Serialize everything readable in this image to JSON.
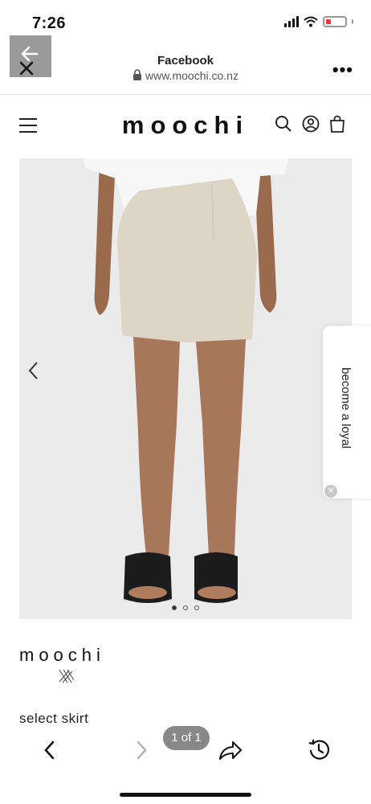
{
  "status_bar": {
    "time": "7:26",
    "icons": [
      "signal-icon",
      "wifi-icon",
      "battery-icon"
    ]
  },
  "browser": {
    "title": "Facebook",
    "url": "www.moochi.co.nz",
    "icons": [
      "back-arrow-icon",
      "close-icon",
      "lock-icon",
      "more-icon"
    ]
  },
  "site_nav": {
    "logo": "moochi",
    "icons": [
      "menu-icon",
      "search-icon",
      "account-icon",
      "bag-icon"
    ]
  },
  "carousel": {
    "image_subject": "linen mini skirt product photo",
    "dots": 3,
    "active_dot": 0
  },
  "loyalty_tab": {
    "text": "become a loyal",
    "icons": [
      "close-icon"
    ]
  },
  "product": {
    "brand": "moochi",
    "select_label": "select skirt"
  },
  "toolbar": {
    "pager": "1 of 1",
    "icons": [
      "back-icon",
      "forward-icon",
      "share-icon",
      "history-icon"
    ]
  },
  "colors": {
    "background": "#ffffff",
    "hero_bg": "#ebebeb",
    "back_box": "#9a9a9a",
    "pager_bg": "#888888"
  }
}
